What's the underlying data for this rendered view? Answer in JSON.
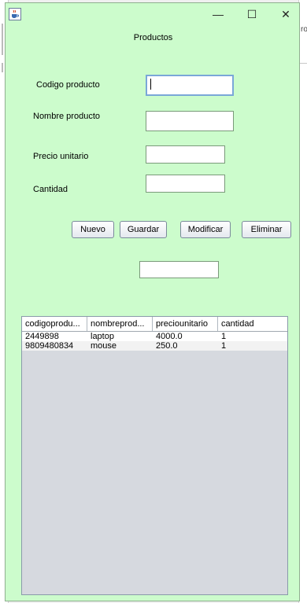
{
  "window": {
    "title": "Productos",
    "controls": {
      "minimize": "—",
      "maximize": "☐",
      "close": "✕"
    }
  },
  "background": {
    "right_text": "ro"
  },
  "form": {
    "codigo_label": "Codigo producto",
    "nombre_label": "Nombre producto",
    "precio_label": "Precio unitario",
    "cantidad_label": "Cantidad",
    "codigo_value": "",
    "nombre_value": "",
    "precio_value": "",
    "cantidad_value": "",
    "search_value": ""
  },
  "buttons": {
    "nuevo": "Nuevo",
    "guardar": "Guardar",
    "modificar": "Modificar",
    "eliminar": "Eliminar"
  },
  "table": {
    "headers": [
      "codigoprodu...",
      "nombreprod...",
      "preciounitario",
      "cantidad"
    ],
    "rows": [
      [
        "2449898",
        "laptop",
        "4000.0",
        "1"
      ],
      [
        "9809480834",
        "mouse",
        "250.0",
        "1"
      ]
    ]
  },
  "colors": {
    "form_background": "#ccfccc",
    "table_empty": "#d6d9df"
  }
}
